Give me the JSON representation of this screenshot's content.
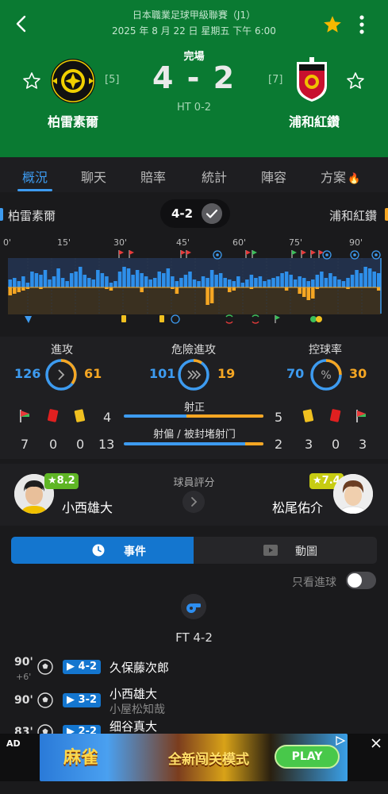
{
  "header": {
    "league": "日本職業足球甲級聯賽（J1）",
    "datetime": "2025 年 8 月 22 日 星期五 下午 6:00",
    "status": "完場",
    "score": "4 - 2",
    "halftime": "HT 0-2",
    "home": {
      "name": "柏雷素爾",
      "rank": "[5]"
    },
    "away": {
      "name": "浦和紅鑽",
      "rank": "[7]"
    },
    "colors": {
      "bg": "#0a7a32",
      "star": "#f5b800"
    }
  },
  "tabs": [
    {
      "label": "概況",
      "active": true
    },
    {
      "label": "聊天"
    },
    {
      "label": "賠率"
    },
    {
      "label": "統計"
    },
    {
      "label": "陣容"
    },
    {
      "label": "方案"
    }
  ],
  "timeline": {
    "home_name": "柏雷素爾",
    "away_name": "浦和紅鑽",
    "score": "4-2",
    "minute_labels": [
      "0'",
      "15'",
      "30'",
      "45'",
      "60'",
      "75'",
      "90'"
    ],
    "colors": {
      "home": "#3d9bf0",
      "away": "#f5a623"
    }
  },
  "stats": {
    "attack": {
      "label": "進攻",
      "home": "126",
      "away": "61"
    },
    "dangerous": {
      "label": "危險進攻",
      "home": "101",
      "away": "19"
    },
    "possession": {
      "label": "控球率",
      "home": "70",
      "away": "30"
    },
    "on_target": {
      "label": "射正",
      "home": "4",
      "away": "5"
    },
    "off_target": {
      "label": "射偏 / 被封堵射门",
      "home": "13",
      "away": "2"
    },
    "home_counts": {
      "corners": "7",
      "red": "0",
      "yellow": "0"
    },
    "away_counts": {
      "yellow": "3",
      "red": "0",
      "corners": "3"
    }
  },
  "ratings": {
    "title": "球員評分",
    "home": {
      "rating": "★8.2",
      "name": "小西雄大"
    },
    "away": {
      "rating": "★7.4",
      "name": "松尾佑介"
    }
  },
  "events": {
    "tab_events": "事件",
    "tab_animation": "動圖",
    "only_goals": "只看進球",
    "final": "FT 4-2",
    "list": [
      {
        "minute": "90'",
        "extra": "+6'",
        "score": "▶ 4-2",
        "player": "久保藤次郎",
        "assist": ""
      },
      {
        "minute": "90'",
        "extra": "",
        "score": "▶ 3-2",
        "player": "小西雄大",
        "assist": "小屋松知哉"
      },
      {
        "minute": "83'",
        "extra": "",
        "score": "▶ 2-2",
        "player": "细谷真大",
        "assist": ""
      }
    ]
  },
  "ad": {
    "label": "AD",
    "title_left": "麻雀",
    "title_mid": "全新闯关模式",
    "cta": "PLAY"
  }
}
